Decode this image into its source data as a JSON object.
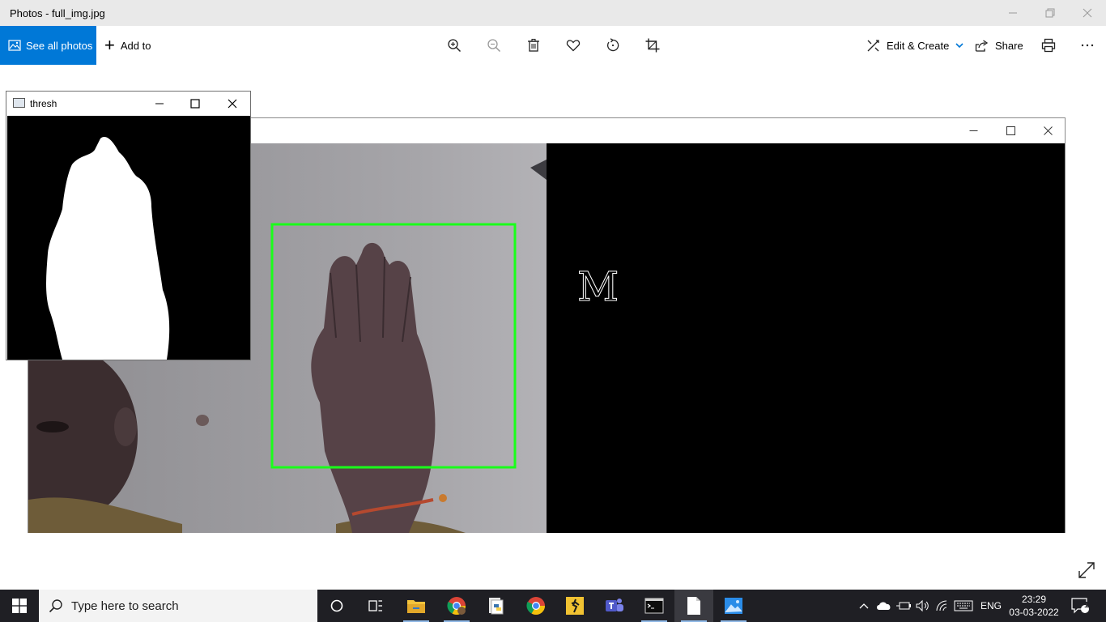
{
  "window": {
    "title": "Photos - full_img.jpg"
  },
  "toolbar": {
    "see_all_label": "See all photos",
    "add_to_label": "Add to",
    "edit_create_label": "Edit & Create",
    "share_label": "Share"
  },
  "thresh_window": {
    "title": "thresh"
  },
  "image_window": {
    "predicted_letter": "M"
  },
  "taskbar": {
    "search_placeholder": "Type here to search",
    "language": "ENG",
    "time": "23:29",
    "date": "03-03-2022",
    "notification_count": "1"
  },
  "colors": {
    "accent": "#0078d7",
    "roi_box": "#1aff1a",
    "taskbar": "#1f1f24"
  }
}
